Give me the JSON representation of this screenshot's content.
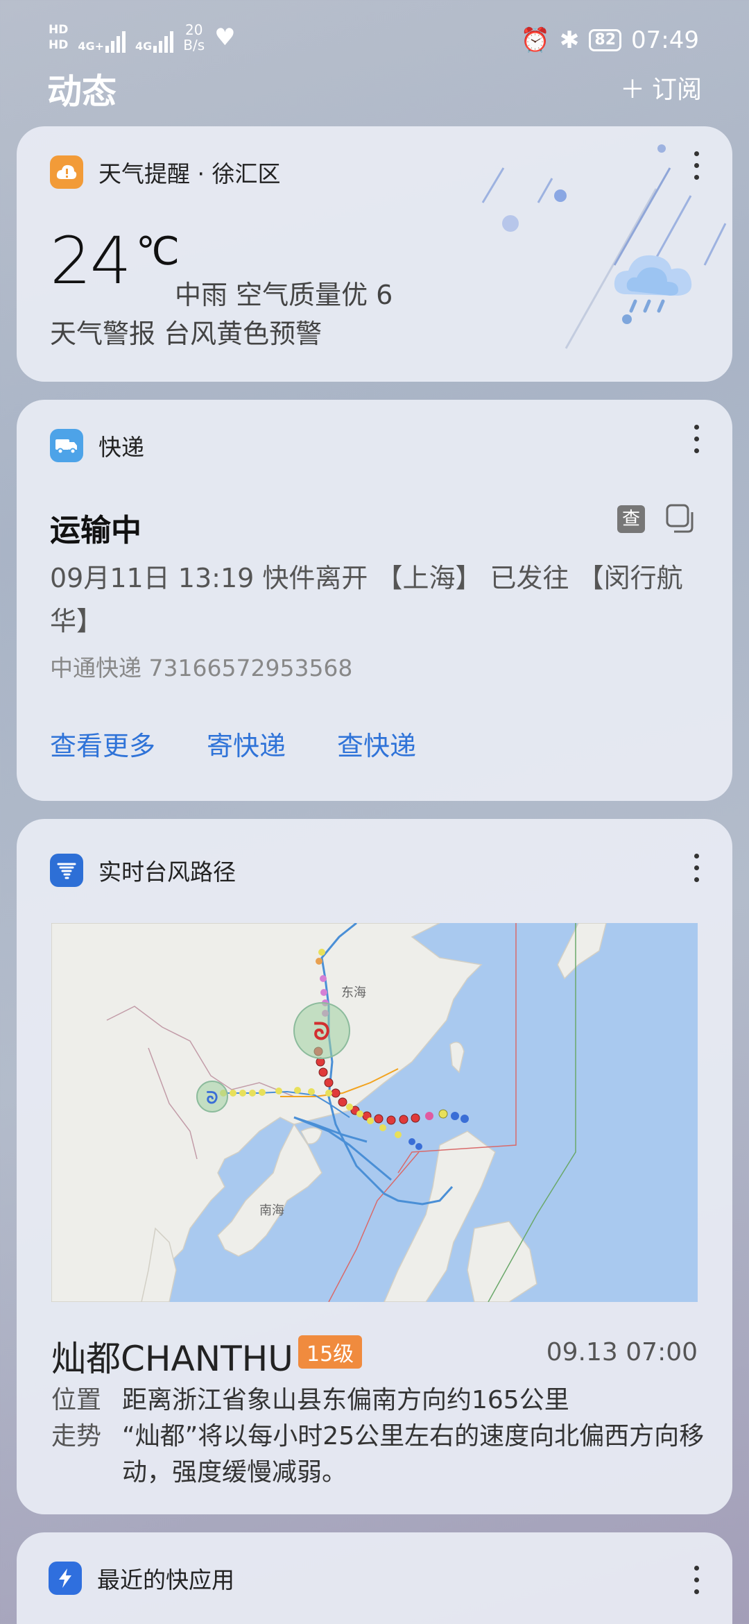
{
  "status_bar": {
    "hd1": "HD",
    "hd2": "HD",
    "sig1": "4G+",
    "sig2": "4G",
    "speed_value": "20",
    "speed_unit": "B/s",
    "battery": "82",
    "time": "07:49"
  },
  "header": {
    "title": "动态",
    "subscribe_label": "订阅"
  },
  "weather": {
    "title": "天气提醒 · 徐汇区",
    "temp": "24",
    "unit": "℃",
    "condition": "中雨  空气质量优  6",
    "alert": "天气警报 台风黄色预警"
  },
  "express": {
    "title": "快递",
    "status": "运输中",
    "check_label": "查",
    "detail": "09月11日 13:19  快件离开 【上海】 已发往 【闵行航华】",
    "tracking": "中通快递 73166572953568",
    "actions": [
      "查看更多",
      "寄快递",
      "查快递"
    ]
  },
  "typhoon": {
    "title": "实时台风路径",
    "map_labels": {
      "east_sea": "东海",
      "south_sea": "南海"
    },
    "name": "灿都CHANTHU",
    "level": "15级",
    "time": "09.13 07:00",
    "position_label": "位置",
    "position": "距离浙江省象山县东偏南方向约165公里",
    "trend_label": "走势",
    "trend": "“灿都”将以每小时25公里左右的速度向北偏西方向移动，强度缓慢减弱。"
  },
  "quick_apps": {
    "title": "最近的快应用"
  },
  "colors": {
    "accent": "#2f73d8",
    "badge": "#f08b3e",
    "weather_icon": "#f29b38",
    "express_icon": "#4da3e8",
    "typhoon_icon": "#2d6fd6"
  }
}
